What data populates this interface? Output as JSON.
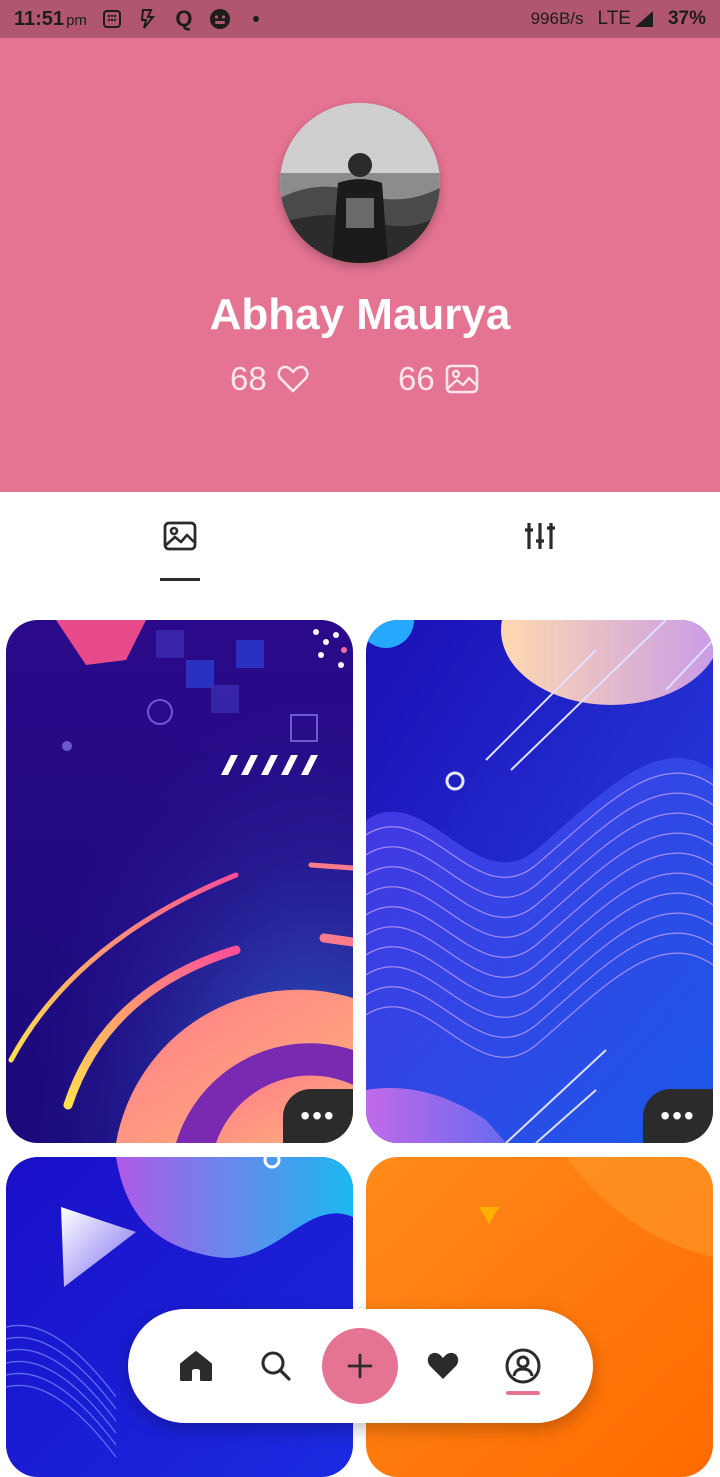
{
  "status_bar": {
    "time": "11:51",
    "ampm": "pm",
    "net_speed": "996B/s",
    "network": "LTE",
    "battery": "37%"
  },
  "profile": {
    "name": "Abhay Maurya",
    "likes_count": "68",
    "photos_count": "66"
  },
  "tabs": [
    {
      "name": "gallery",
      "icon": "image-icon",
      "active": true
    },
    {
      "name": "filters",
      "icon": "sliders-icon",
      "active": false
    }
  ],
  "cards": [
    {
      "more_label": "•••"
    },
    {
      "more_label": "•••"
    }
  ],
  "bottom_nav": [
    {
      "icon": "home-icon"
    },
    {
      "icon": "search-icon"
    },
    {
      "icon": "plus-icon"
    },
    {
      "icon": "heart-icon"
    },
    {
      "icon": "profile-icon",
      "active": true
    }
  ],
  "colors": {
    "accent": "#e57492",
    "status_bar": "#b0566f",
    "dark": "#2b2b2b"
  }
}
